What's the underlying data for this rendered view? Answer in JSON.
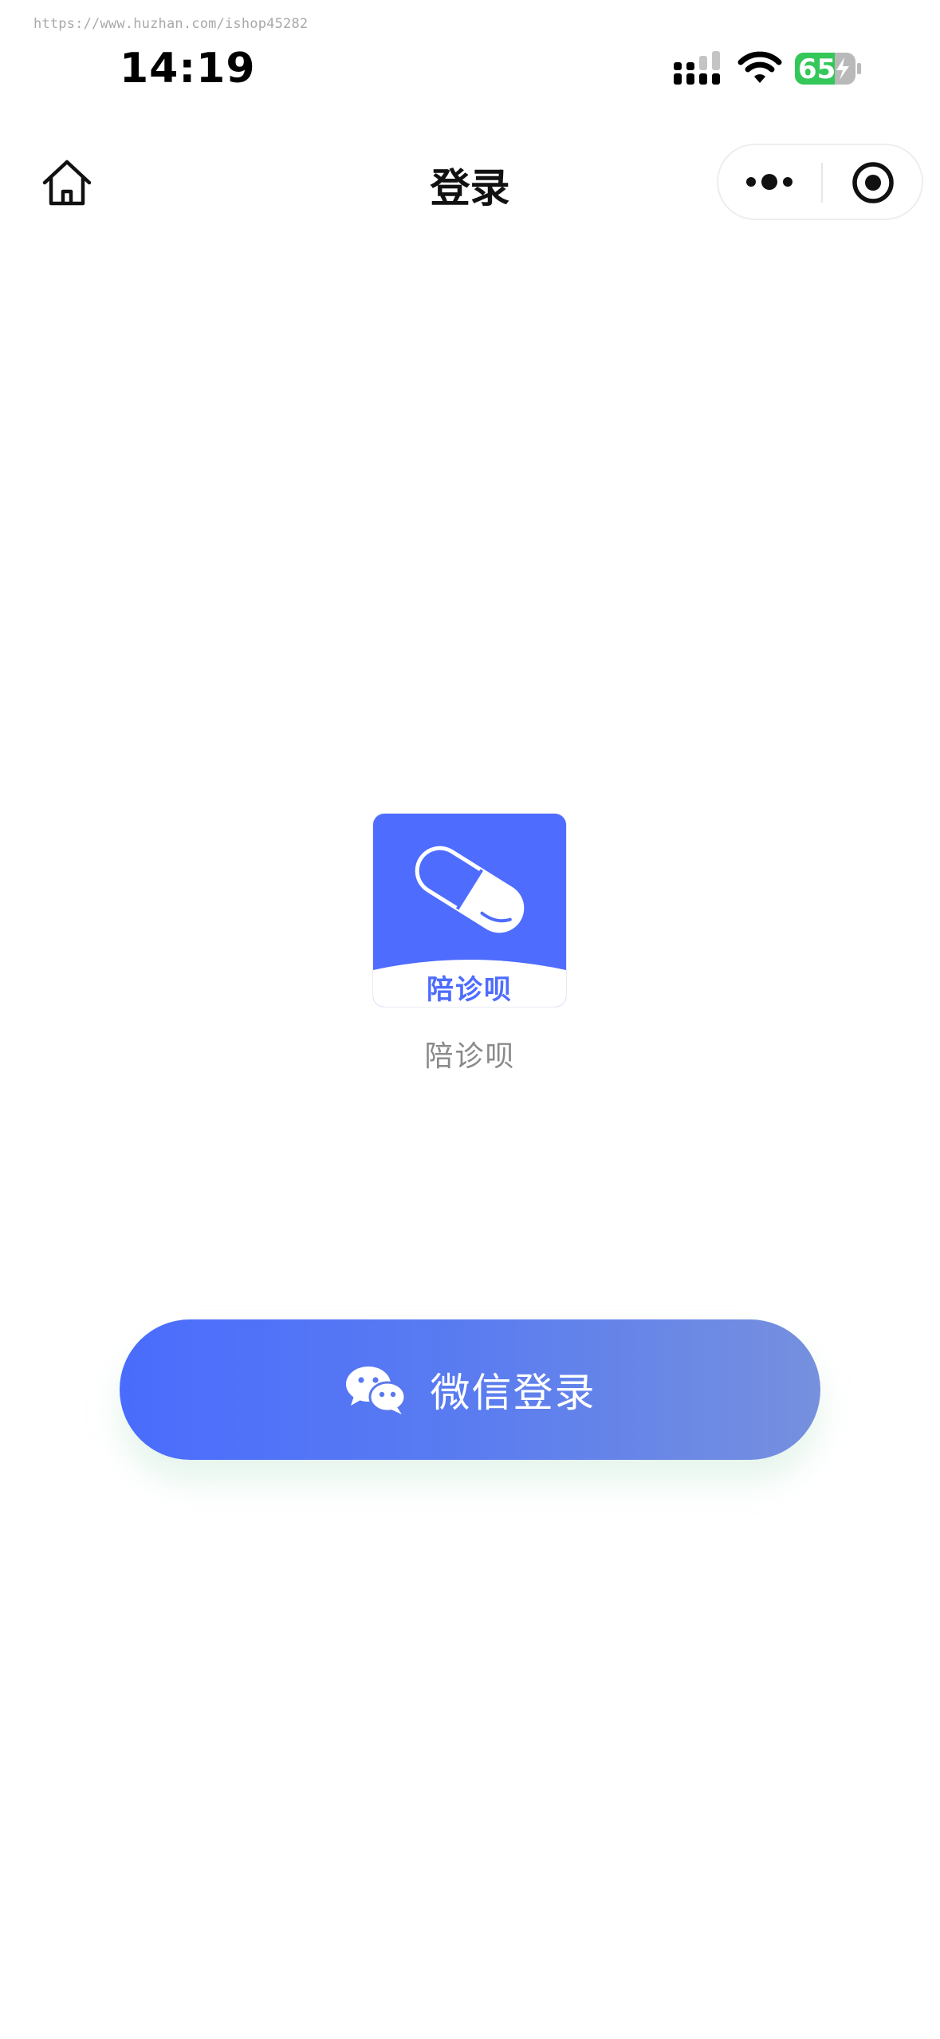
{
  "watermark": "https://www.huzhan.com/ishop45282",
  "status_bar": {
    "time": "14:19",
    "battery_level": "65",
    "signal_icon": "cellular-signal-icon",
    "wifi_icon": "wifi-icon",
    "battery_icon": "battery-charging-icon"
  },
  "nav": {
    "title": "登录",
    "home_icon": "home-icon",
    "more_icon": "more-dots-icon",
    "close_icon": "miniprogram-close-icon"
  },
  "logo": {
    "label": "陪诊呗",
    "icon": "capsule-pill-icon",
    "bg_color": "#4e6cfe"
  },
  "app_name": "陪诊呗",
  "login_button": {
    "label": "微信登录",
    "icon": "wechat-icon",
    "gradient_start": "#4a6cfd",
    "gradient_end": "#7690de"
  }
}
